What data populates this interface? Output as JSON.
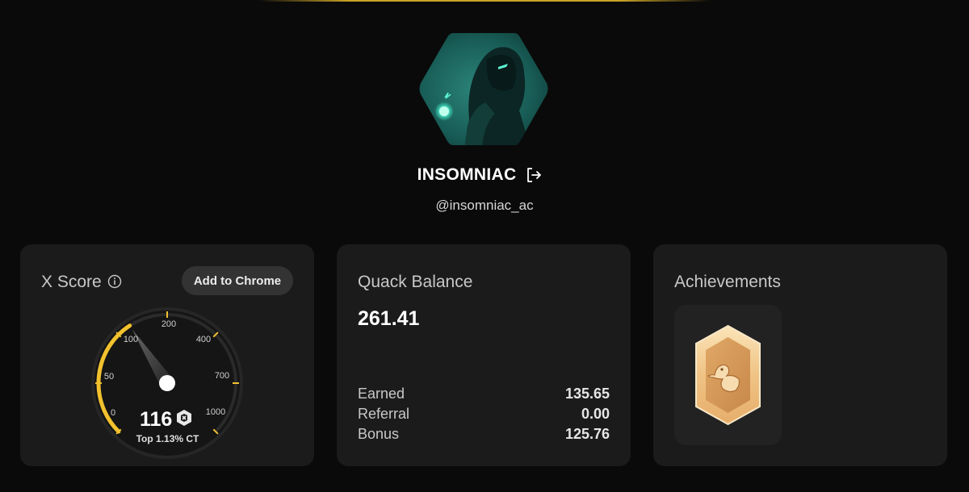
{
  "profile": {
    "display_name": "INSOMNIAC",
    "handle": "@insomniac_ac",
    "avatar_colors": {
      "dark": "#0d2a28",
      "mid": "#1f6f66",
      "glow": "#3fe8c8"
    }
  },
  "x_score": {
    "title": "X Score",
    "add_to_chrome_label": "Add to Chrome",
    "value": "116",
    "rank": "Top 1.13% CT",
    "gauge_ticks": [
      "0",
      "50",
      "100",
      "200",
      "400",
      "700",
      "1000"
    ],
    "accent_color": "#f2c12e"
  },
  "quack_balance": {
    "title": "Quack Balance",
    "value": "261.41",
    "breakdown": [
      {
        "label": "Earned",
        "value": "135.65"
      },
      {
        "label": "Referral",
        "value": "0.00"
      },
      {
        "label": "Bonus",
        "value": "125.76"
      }
    ]
  },
  "achievements": {
    "title": "Achievements",
    "badges": [
      {
        "icon": "duck-badge-icon",
        "color": "#d9a76a"
      }
    ]
  }
}
